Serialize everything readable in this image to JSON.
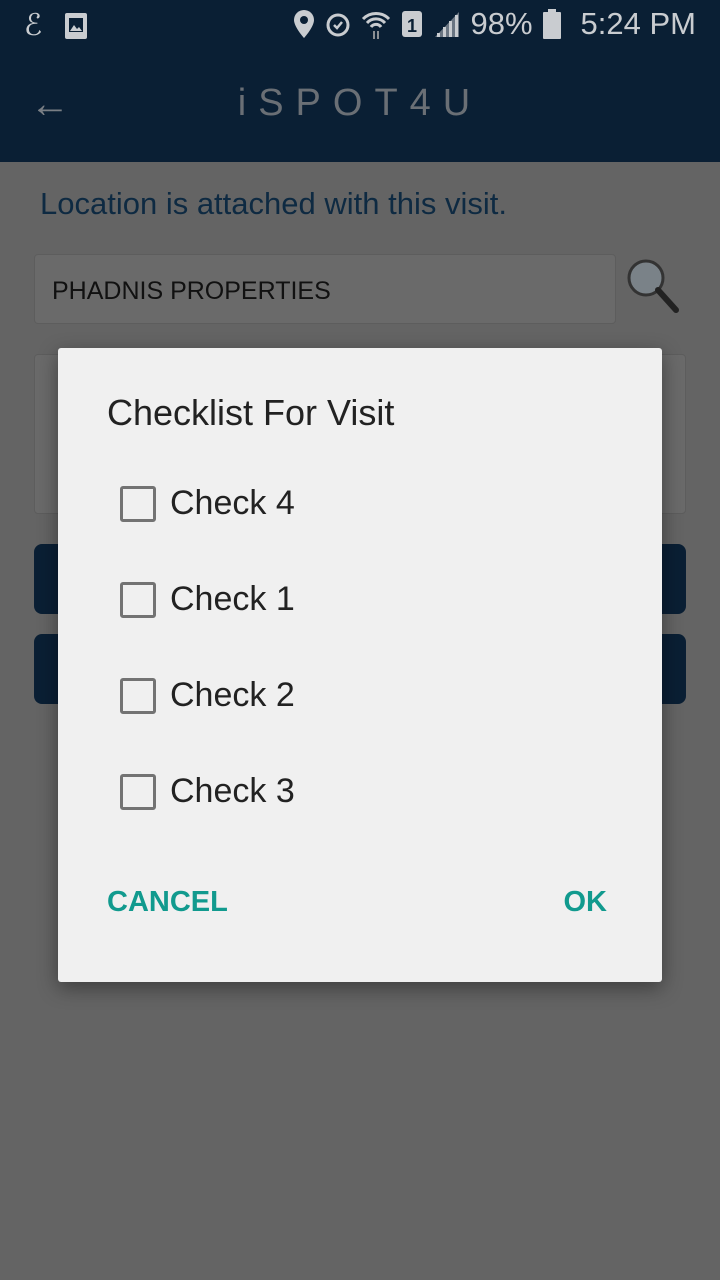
{
  "status_bar": {
    "battery": "98%",
    "time": "5:24 PM",
    "icons": [
      "app-notification-icon",
      "gallery-icon",
      "location-icon",
      "alarm-icon",
      "wifi-icon",
      "sim-1-icon",
      "signal-icon",
      "battery-icon"
    ]
  },
  "app_bar": {
    "title": "iSPOT4U",
    "back_icon": "arrow-left-icon"
  },
  "content": {
    "location_text": "Location is attached with this visit.",
    "property_field": "PHADNIS PROPERTIES",
    "search_icon": "magnifier-icon"
  },
  "dialog": {
    "title": "Checklist For Visit",
    "items": [
      {
        "label": "Check 4",
        "checked": false
      },
      {
        "label": "Check 1",
        "checked": false
      },
      {
        "label": "Check 2",
        "checked": false
      },
      {
        "label": "Check 3",
        "checked": false
      }
    ],
    "cancel": "CANCEL",
    "ok": "OK"
  },
  "colors": {
    "primary": "#0a1f34",
    "accent": "#119a8e"
  }
}
